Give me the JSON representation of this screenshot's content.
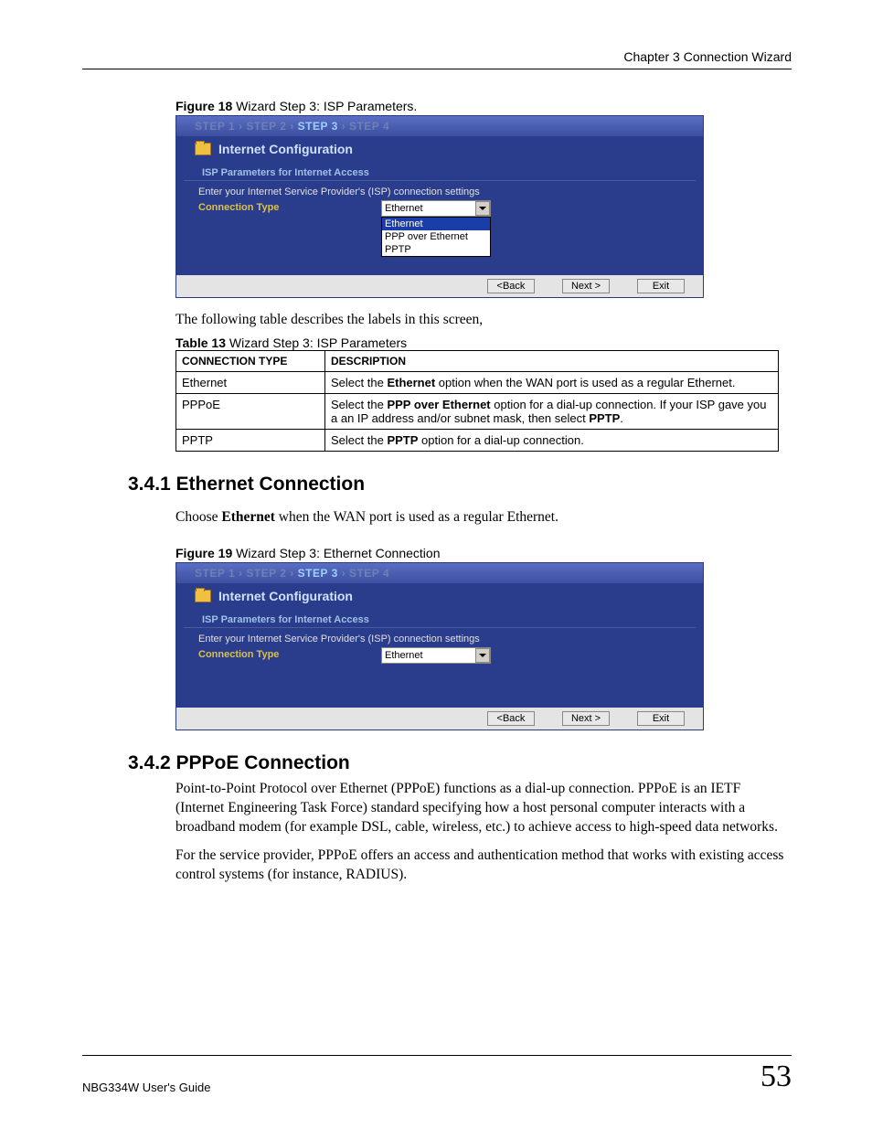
{
  "header": {
    "chapter": "Chapter 3 Connection Wizard"
  },
  "fig18": {
    "label_bold": "Figure 18",
    "label_rest": "   Wizard Step 3: ISP Parameters."
  },
  "wizard1": {
    "steps": {
      "s1": "STEP 1",
      "s2": "STEP 2",
      "s3": "STEP 3",
      "s4": "STEP 4",
      "sep": " › "
    },
    "title": "Internet Configuration",
    "subtitle": "ISP Parameters for Internet Access",
    "instruction": "Enter your Internet Service Provider's (ISP) connection settings",
    "conn_label": "Connection Type",
    "selected": "Ethernet",
    "options": {
      "o1": "Ethernet",
      "o2": "PPP over Ethernet",
      "o3": "PPTP"
    },
    "btn_back": "<Back",
    "btn_next": "Next >",
    "btn_exit": "Exit"
  },
  "para1": "The following table describes the labels in this screen,",
  "tbl13": {
    "label_bold": "Table 13",
    "label_rest": "   Wizard Step 3: ISP Parameters",
    "h1": "CONNECTION TYPE",
    "h2": "DESCRIPTION",
    "r1c1": "Ethernet",
    "r1c2a": "Select the ",
    "r1c2b": "Ethernet",
    "r1c2c": " option when the WAN port is used as a regular Ethernet.",
    "r2c1": "PPPoE",
    "r2c2a": "Select the ",
    "r2c2b": "PPP over Ethernet",
    "r2c2c": " option for a dial-up connection. If your ISP gave you a an IP address and/or subnet mask, then select ",
    "r2c2d": "PPTP",
    "r2c2e": ".",
    "r3c1": "PPTP",
    "r3c2a": "Select the ",
    "r3c2b": "PPTP",
    "r3c2c": " option for a dial-up connection."
  },
  "sec341": {
    "heading": "3.4.1  Ethernet Connection",
    "para_a": "Choose ",
    "para_b": "Ethernet",
    "para_c": " when the WAN port is used as a regular Ethernet."
  },
  "fig19": {
    "label_bold": "Figure 19",
    "label_rest": "   Wizard Step 3: Ethernet Connection"
  },
  "wizard2": {
    "selected": "Ethernet"
  },
  "sec342": {
    "heading": "3.4.2  PPPoE Connection",
    "para1": "Point-to-Point Protocol over Ethernet (PPPoE) functions as a dial-up connection. PPPoE is an IETF (Internet Engineering Task Force) standard specifying how a host personal computer interacts with a broadband modem (for example DSL, cable, wireless, etc.) to achieve access to high-speed data networks.",
    "para2": "For the service provider, PPPoE offers an access and authentication method that works with existing access control systems (for instance, RADIUS)."
  },
  "footer": {
    "guide": "NBG334W User's Guide",
    "page": "53"
  }
}
